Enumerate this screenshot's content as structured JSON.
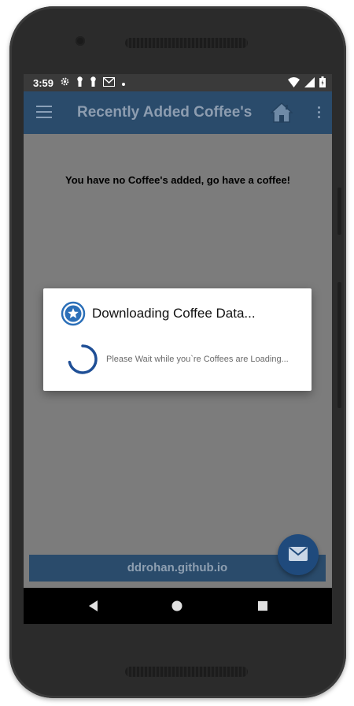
{
  "status_bar": {
    "time": "3:59",
    "left_icons": [
      "settings-icon",
      "keyhole-icon",
      "keyhole-icon",
      "gmail-icon",
      "dot-icon"
    ],
    "right_icons": [
      "wifi-icon",
      "signal-icon",
      "battery-icon"
    ]
  },
  "app_bar": {
    "title": "Recently Added Coffee's",
    "icons": [
      "menu-icon",
      "home-icon",
      "overflow-menu-icon"
    ]
  },
  "main": {
    "empty_message": "You have no Coffee's added, go have a coffee!"
  },
  "dialog": {
    "title": "Downloading Coffee Data...",
    "message": "Please Wait while you`re Coffees are Loading...",
    "icon": "star-badge-icon"
  },
  "footer": {
    "text": "ddrohan.github.io"
  },
  "fab": {
    "icon": "mail-icon"
  },
  "nav_bar": {
    "buttons": [
      "back-icon",
      "home-circle-icon",
      "recents-square-icon"
    ]
  },
  "colors": {
    "app_bar": "#2a4b6b",
    "screen_dim": "#7c7c7c",
    "fab": "#1f4a7c",
    "accent_blue": "#2b6fb8"
  }
}
